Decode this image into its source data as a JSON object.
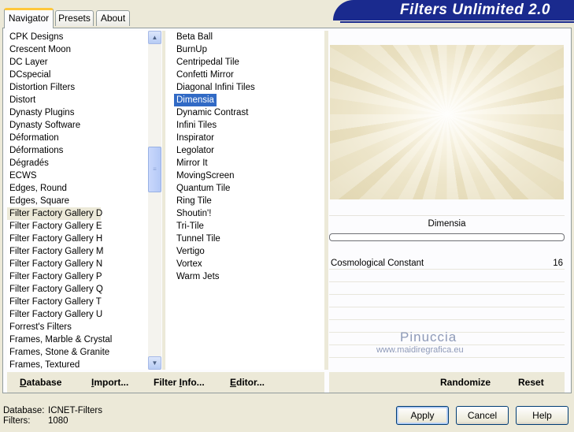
{
  "tabs": [
    {
      "label": "Navigator",
      "active": true
    },
    {
      "label": "Presets",
      "active": false
    },
    {
      "label": "About",
      "active": false
    }
  ],
  "banner": {
    "title": "Filters Unlimited 2.0",
    "color": "#1a2a8e"
  },
  "categories": {
    "items": [
      "CPK Designs",
      "Crescent Moon",
      "DC Layer",
      "DCspecial",
      "Distortion Filters",
      "Distort",
      "Dynasty Plugins",
      "Dynasty Software",
      "Déformation",
      "Déformations",
      "Dégradés",
      "ECWS",
      "Edges, Round",
      "Edges, Square",
      "Filter Factory Gallery D",
      "Filter Factory Gallery E",
      "Filter Factory Gallery H",
      "Filter Factory Gallery M",
      "Filter Factory Gallery N",
      "Filter Factory Gallery P",
      "Filter Factory Gallery Q",
      "Filter Factory Gallery T",
      "Filter Factory Gallery U",
      "Forrest's Filters",
      "Frames, Marble & Crystal",
      "Frames, Stone & Granite",
      "Frames, Textured"
    ],
    "selected": "Filter Factory Gallery D"
  },
  "filters": {
    "items": [
      "Beta Ball",
      "BurnUp",
      "Centripedal Tile",
      "Confetti Mirror",
      "Diagonal Infini Tiles",
      "Dimensia",
      "Dynamic Contrast",
      "Infini Tiles",
      "Inspirator",
      "Legolator",
      "Mirror It",
      "MovingScreen",
      "Quantum Tile",
      "Ring Tile",
      "Shoutin'!",
      "Tri-Tile",
      "Tunnel Tile",
      "Vertigo",
      "Vortex",
      "Warm Jets"
    ],
    "selected": "Dimensia",
    "selected_color": "#316ac5"
  },
  "preview": {
    "filter_name": "Dimensia"
  },
  "parameters": [
    {
      "label": "Cosmological Constant",
      "value": "16"
    }
  ],
  "watermark": {
    "name": "Pinuccia",
    "site": "www.maidiregrafica.eu"
  },
  "toolbar": {
    "database": {
      "underline": "D",
      "rest": "atabase"
    },
    "import": {
      "underline": "I",
      "rest": "mport..."
    },
    "filter_info": {
      "pre": "Filter ",
      "underline": "I",
      "rest": "nfo..."
    },
    "editor": {
      "underline": "E",
      "rest": "ditor..."
    },
    "randomize": "Randomize",
    "reset": "Reset"
  },
  "status": {
    "database_label": "Database:",
    "database_value": "ICNET-Filters",
    "filters_label": "Filters:",
    "filters_value": "1080"
  },
  "buttons": {
    "apply": "Apply",
    "cancel": "Cancel",
    "help": "Help"
  }
}
